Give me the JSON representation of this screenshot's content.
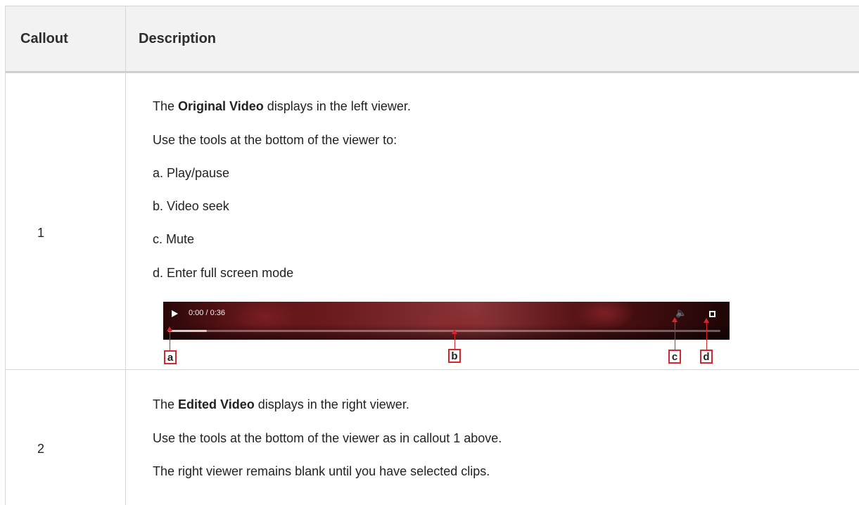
{
  "table": {
    "headers": {
      "callout": "Callout",
      "description": "Description"
    },
    "rows": [
      {
        "callout": "1",
        "intro_prefix": "The ",
        "intro_bold": "Original Video",
        "intro_suffix": " displays in the left viewer.",
        "lead": "Use the tools at the bottom of the viewer to:",
        "items": [
          "a. Play/pause",
          "b. Video seek",
          "c. Mute",
          "d. Enter full screen mode"
        ],
        "player": {
          "time": "0:00 / 0:36",
          "progress": 0.07,
          "icons": [
            "play-icon",
            "volume-icon",
            "fullscreen-icon"
          ],
          "callout_labels": [
            "a",
            "b",
            "c",
            "d"
          ],
          "callout_color": "#d9262c"
        }
      },
      {
        "callout": "2",
        "intro_prefix": "The ",
        "intro_bold": "Edited Video",
        "intro_suffix": " displays in the right viewer.",
        "line2": "Use the tools at the bottom of the viewer as in callout 1 above.",
        "line3": "The right viewer remains blank until you have selected clips."
      }
    ]
  }
}
